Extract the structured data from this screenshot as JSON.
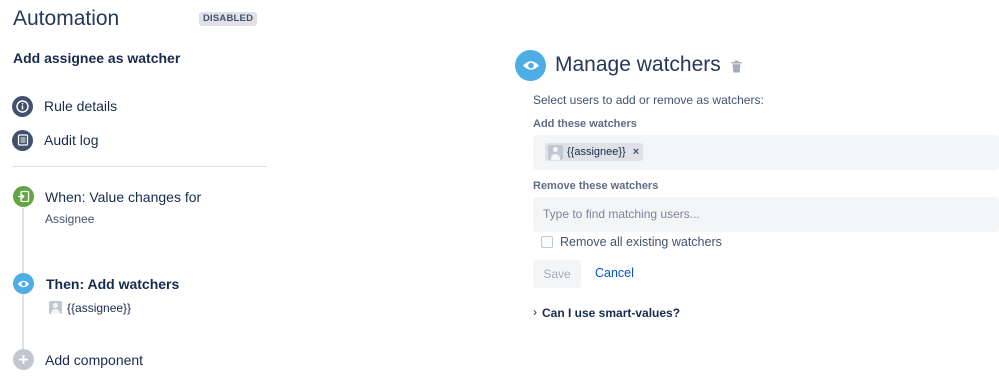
{
  "header": {
    "title": "Automation",
    "status_badge": "DISABLED",
    "rule_name": "Add assignee as watcher"
  },
  "nav": {
    "rule_details": "Rule details",
    "audit_log": "Audit log"
  },
  "timeline": {
    "trigger": {
      "title": "When: Value changes for",
      "subtitle": "Assignee"
    },
    "action": {
      "title": "Then: Add watchers",
      "value": "{{assignee}}"
    },
    "add_component": "Add component"
  },
  "panel": {
    "title": "Manage watchers",
    "description": "Select users to add or remove as watchers:",
    "add_label": "Add these watchers",
    "add_chip": "{{assignee}}",
    "chip_remove": "×",
    "remove_label": "Remove these watchers",
    "remove_placeholder": "Type to find matching users...",
    "remove_all_label": "Remove all existing watchers",
    "save_label": "Save",
    "cancel_label": "Cancel",
    "help_chevron": "›",
    "help_link": "Can I use smart-values?"
  },
  "colors": {
    "trigger_green": "#63a540",
    "action_blue": "#4fade6",
    "nav_dark": "#42526e",
    "link_blue": "#0052cc"
  },
  "icons": {
    "rule_details": "info-icon",
    "audit_log": "log-icon",
    "trigger": "trigger-icon",
    "action": "eye-icon",
    "add": "plus-icon",
    "delete": "trash-icon"
  }
}
